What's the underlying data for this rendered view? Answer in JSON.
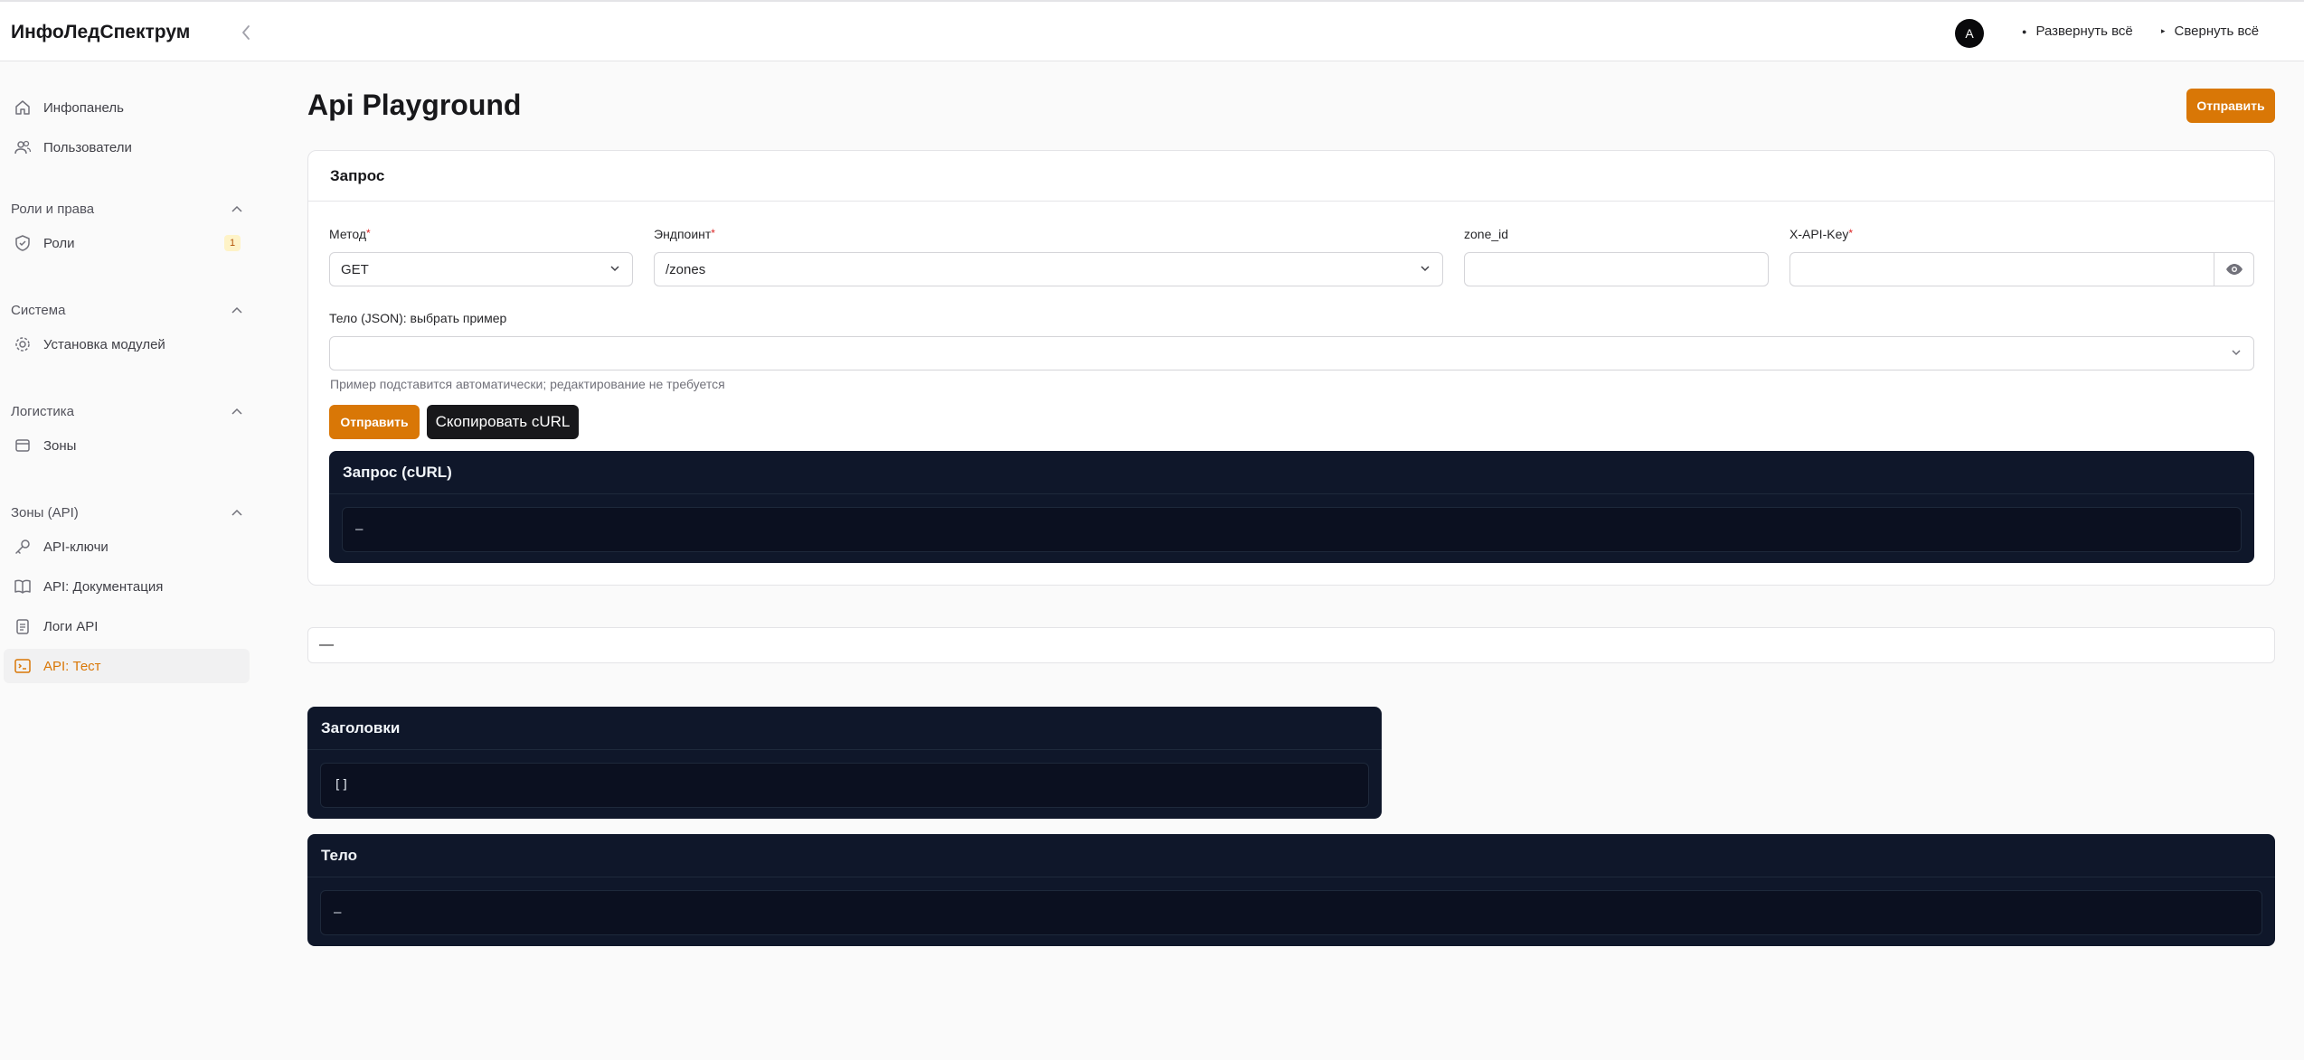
{
  "header": {
    "brand": "ИнфоЛедСпектрум",
    "avatar_letter": "A",
    "expand_all": "Развернуть всё",
    "collapse_all": "Свернуть всё"
  },
  "sidebar": {
    "items": [
      {
        "label": "Инфопанель",
        "icon": "home-icon"
      },
      {
        "label": "Пользователи",
        "icon": "users-icon"
      }
    ],
    "groups": [
      {
        "label": "Роли и права",
        "items": [
          {
            "label": "Роли",
            "icon": "shield-icon",
            "badge": "1"
          }
        ]
      },
      {
        "label": "Система",
        "items": [
          {
            "label": "Установка модулей",
            "icon": "gear-icon"
          }
        ]
      },
      {
        "label": "Логистика",
        "items": [
          {
            "label": "Зоны",
            "icon": "box-icon"
          }
        ]
      },
      {
        "label": "Зоны (API)",
        "items": [
          {
            "label": "API-ключи",
            "icon": "key-icon"
          },
          {
            "label": "API: Документация",
            "icon": "book-icon"
          },
          {
            "label": "Логи API",
            "icon": "clipboard-icon"
          },
          {
            "label": "API: Тест",
            "icon": "terminal-icon",
            "active": true
          }
        ]
      }
    ]
  },
  "main": {
    "title": "Api Playground",
    "send_label": "Отправить",
    "request_card": {
      "title": "Запрос",
      "method_label": "Метод",
      "method_value": "GET",
      "endpoint_label": "Эндпоинт",
      "endpoint_value": "/zones",
      "zone_id_label": "zone_id",
      "zone_id_value": "",
      "api_key_label": "X-API-Key",
      "api_key_value": "",
      "body_label": "Тело (JSON): выбрать пример",
      "body_value": "",
      "hint": "Пример подставится автоматически; редактирование не требуется",
      "send_label": "Отправить",
      "copy_curl_label": "Скопировать cURL"
    },
    "curl_panel": {
      "title": "Запрос (cURL)",
      "content": "—"
    },
    "status_text": "—",
    "headers_panel": {
      "title": "Заголовки",
      "content": "[]"
    },
    "body_panel": {
      "title": "Тело",
      "content": "—"
    }
  },
  "colors": {
    "accent": "#d97706",
    "dark_panel": "#0f172a",
    "required": "#dc2626"
  }
}
